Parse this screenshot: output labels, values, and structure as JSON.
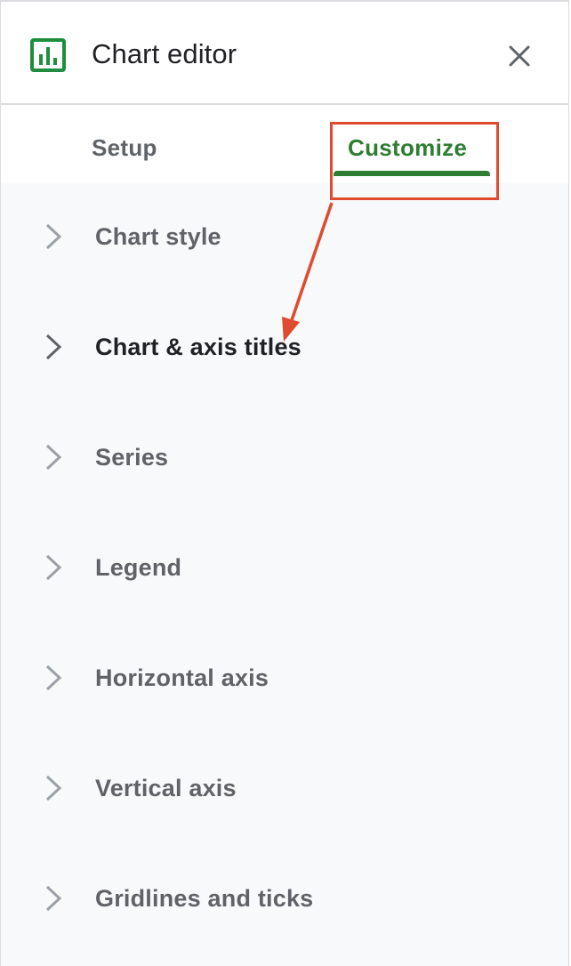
{
  "header": {
    "title": "Chart editor",
    "icon": "bar-chart-icon",
    "close_icon": "close-icon",
    "accent_color": "#1e8e3e"
  },
  "tabs": [
    {
      "label": "Setup",
      "selected": false
    },
    {
      "label": "Customize",
      "selected": true
    }
  ],
  "sections": [
    {
      "label": "Chart style",
      "icon": "chevron-right-icon"
    },
    {
      "label": "Chart & axis titles",
      "icon": "chevron-right-icon"
    },
    {
      "label": "Series",
      "icon": "chevron-right-icon"
    },
    {
      "label": "Legend",
      "icon": "chevron-right-icon"
    },
    {
      "label": "Horizontal axis",
      "icon": "chevron-right-icon"
    },
    {
      "label": "Vertical axis",
      "icon": "chevron-right-icon"
    },
    {
      "label": "Gridlines and ticks",
      "icon": "chevron-right-icon"
    }
  ],
  "colors": {
    "selected_tab": "#2e7d32",
    "annotation": "#e04a2f",
    "content_background": "#f8f9fa"
  }
}
